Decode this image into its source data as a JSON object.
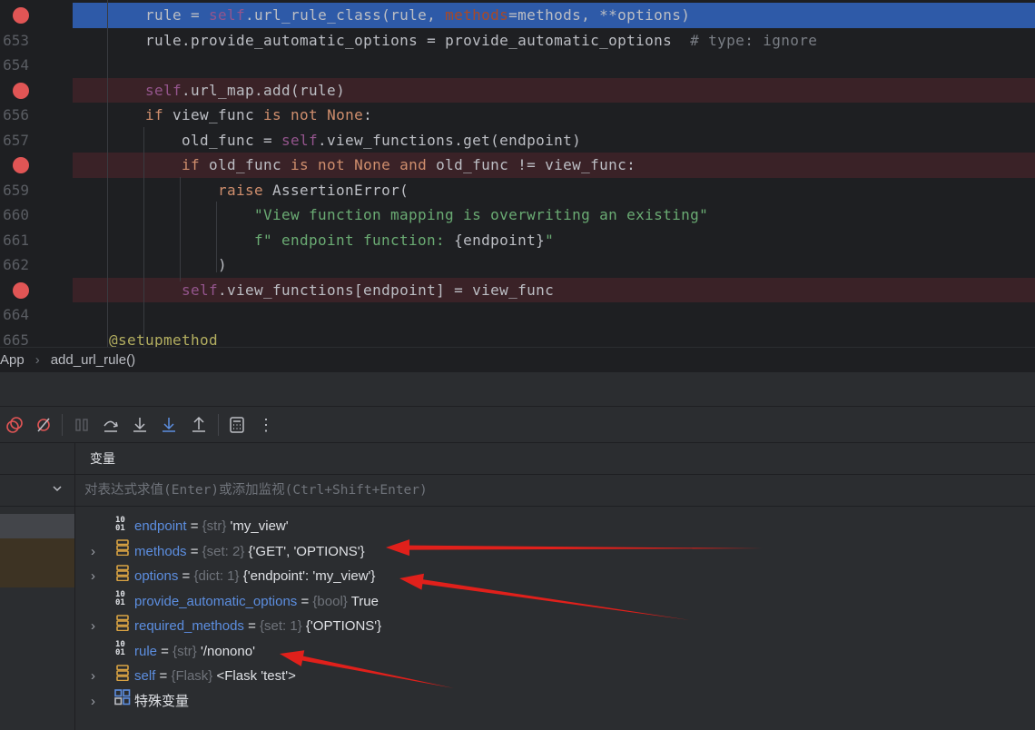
{
  "editor": {
    "lines": [
      {
        "num": "652",
        "breakpoint": true,
        "exec": true,
        "indent": 8,
        "tokens": [
          [
            "rule = ",
            ""
          ],
          [
            "self",
            "self"
          ],
          [
            ".url_rule_class(rule, ",
            ""
          ],
          [
            "methods",
            "arg"
          ],
          [
            "=methods, **options)",
            ""
          ]
        ]
      },
      {
        "num": "653",
        "indent": 8,
        "tokens": [
          [
            "rule.provide_automatic_options = provide_automatic_options  ",
            ""
          ],
          [
            "# type: ignore",
            "cm"
          ]
        ]
      },
      {
        "num": "654",
        "indent": 0,
        "tokens": []
      },
      {
        "num": "655",
        "breakpoint": true,
        "indent": 8,
        "tokens": [
          [
            "self",
            "self"
          ],
          [
            ".url_map.add(rule)",
            ""
          ]
        ]
      },
      {
        "num": "656",
        "indent": 8,
        "tokens": [
          [
            "if ",
            "kw"
          ],
          [
            "view_func ",
            ""
          ],
          [
            "is not None",
            "kw"
          ],
          [
            ":",
            ""
          ]
        ]
      },
      {
        "num": "657",
        "indent": 12,
        "tokens": [
          [
            "old_func = ",
            ""
          ],
          [
            "self",
            "self"
          ],
          [
            ".view_functions.get(endpoint)",
            ""
          ]
        ]
      },
      {
        "num": "658",
        "breakpoint": true,
        "indent": 12,
        "tokens": [
          [
            "if ",
            "kw"
          ],
          [
            "old_func ",
            ""
          ],
          [
            "is not None and ",
            "kw"
          ],
          [
            "old_func != view_func:",
            ""
          ]
        ]
      },
      {
        "num": "659",
        "indent": 16,
        "tokens": [
          [
            "raise ",
            "kw"
          ],
          [
            "AssertionError(",
            ""
          ]
        ]
      },
      {
        "num": "660",
        "indent": 20,
        "tokens": [
          [
            "\"View function mapping is overwriting an existing\"",
            "str"
          ]
        ]
      },
      {
        "num": "661",
        "indent": 20,
        "tokens": [
          [
            "f\" endpoint function: ",
            "str"
          ],
          [
            "{endpoint}",
            ""
          ],
          [
            "\"",
            "str"
          ]
        ]
      },
      {
        "num": "662",
        "indent": 16,
        "tokens": [
          [
            ")",
            ""
          ]
        ]
      },
      {
        "num": "663",
        "breakpoint": true,
        "indent": 12,
        "tokens": [
          [
            "self",
            "self"
          ],
          [
            ".view_functions[endpoint] = view_func",
            ""
          ]
        ]
      },
      {
        "num": "664",
        "indent": 0,
        "tokens": []
      },
      {
        "num": "665",
        "indent": 4,
        "tokens": [
          [
            "@setupmethod",
            "dec"
          ]
        ]
      }
    ]
  },
  "breadcrumb": {
    "items": [
      "App",
      "add_url_rule()"
    ]
  },
  "toolbar": {
    "icons": [
      "view-breakpoints-icon",
      "mute-breakpoints-icon",
      "pause-icon",
      "step-over-icon",
      "step-into-icon",
      "step-into-my-code-icon",
      "step-out-icon",
      "evaluate-expression-icon",
      "more-icon"
    ]
  },
  "variables": {
    "header": "变量",
    "eval_placeholder": "对表达式求值(Enter)或添加监视(Ctrl+Shift+Enter)",
    "items": [
      {
        "expandable": false,
        "icon": "primitive",
        "name": "endpoint",
        "type": "{str}",
        "value": "'my_view'"
      },
      {
        "expandable": true,
        "icon": "collection",
        "name": "methods",
        "type": "{set: 2}",
        "value": "{'GET', 'OPTIONS'}"
      },
      {
        "expandable": true,
        "icon": "collection",
        "name": "options",
        "type": "{dict: 1}",
        "value": "{'endpoint': 'my_view'}"
      },
      {
        "expandable": false,
        "icon": "primitive",
        "name": "provide_automatic_options",
        "type": "{bool}",
        "value": "True"
      },
      {
        "expandable": true,
        "icon": "collection",
        "name": "required_methods",
        "type": "{set: 1}",
        "value": "{'OPTIONS'}"
      },
      {
        "expandable": false,
        "icon": "primitive",
        "name": "rule",
        "type": "{str}",
        "value": "'/nonono'"
      },
      {
        "expandable": true,
        "icon": "collection",
        "name": "self",
        "type": "{Flask}",
        "value": "<Flask 'test'>"
      },
      {
        "expandable": true,
        "icon": "special",
        "name": "",
        "type": "",
        "value": "特殊变量"
      }
    ]
  },
  "annotation_color": "#e0201b"
}
